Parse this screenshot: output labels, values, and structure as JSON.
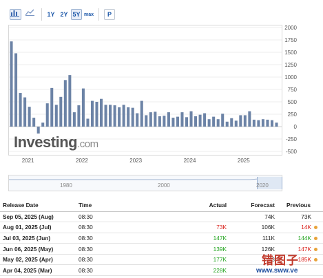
{
  "toolbar": {
    "ranges": [
      "1Y",
      "2Y",
      "5Y",
      "max"
    ],
    "active_range": "5Y",
    "p_label": "P"
  },
  "chart_data": {
    "type": "bar",
    "series": [
      {
        "values": [
          1720,
          1480,
          680,
          590,
          400,
          180,
          -140,
          80,
          470,
          780,
          440,
          600,
          940,
          1040,
          290,
          430,
          770,
          160,
          520,
          500,
          560,
          440,
          440,
          430,
          390,
          440,
          390,
          380,
          270,
          520,
          230,
          290,
          300,
          210,
          220,
          290,
          180,
          200,
          290,
          190,
          310,
          210,
          240,
          270,
          150,
          200,
          150,
          260,
          100,
          170,
          120,
          230,
          230,
          310,
          140,
          130,
          150,
          140,
          130,
          80
        ]
      }
    ],
    "color": "#6c83a6",
    "ylim": [
      -500,
      2000
    ],
    "y_ticks": [
      2000,
      1750,
      1500,
      1250,
      1000,
      750,
      500,
      250,
      0,
      -250,
      -500
    ],
    "x_tick_labels": [
      "2021",
      "2022",
      "2023",
      "2024",
      "2025"
    ],
    "grid": true
  },
  "watermark": {
    "logo_text": "Investing",
    "logo_suffix": ".com"
  },
  "navigator": {
    "labels": [
      "1980",
      "2000",
      "2020"
    ]
  },
  "table": {
    "headers": [
      "Release Date",
      "Time",
      "Actual",
      "Forecast",
      "Previous"
    ],
    "rows": [
      {
        "date": "Sep 05, 2025 (Aug)",
        "time": "08:30",
        "actual": "",
        "actual_color": "",
        "forecast": "74K",
        "previous": "73K",
        "previous_color": "",
        "dot": false
      },
      {
        "date": "Aug 01, 2025 (Jul)",
        "time": "08:30",
        "actual": "73K",
        "actual_color": "red",
        "forecast": "106K",
        "previous": "14K",
        "previous_color": "red",
        "dot": true
      },
      {
        "date": "Jul 03, 2025 (Jun)",
        "time": "08:30",
        "actual": "147K",
        "actual_color": "green",
        "forecast": "111K",
        "previous": "144K",
        "previous_color": "green",
        "dot": true
      },
      {
        "date": "Jun 06, 2025 (May)",
        "time": "08:30",
        "actual": "139K",
        "actual_color": "green",
        "forecast": "126K",
        "previous": "147K",
        "previous_color": "red",
        "dot": true
      },
      {
        "date": "May 02, 2025 (Apr)",
        "time": "08:30",
        "actual": "177K",
        "actual_color": "green",
        "forecast": "13",
        "previous": "185K",
        "previous_color": "red",
        "dot": true
      },
      {
        "date": "Apr 04, 2025 (Mar)",
        "time": "08:30",
        "actual": "228K",
        "actual_color": "green",
        "forecast": "",
        "previous": "",
        "previous_color": "",
        "dot": false
      }
    ]
  },
  "overlay_watermark": {
    "cn": "错图子",
    "url": "www.sww.ve"
  }
}
